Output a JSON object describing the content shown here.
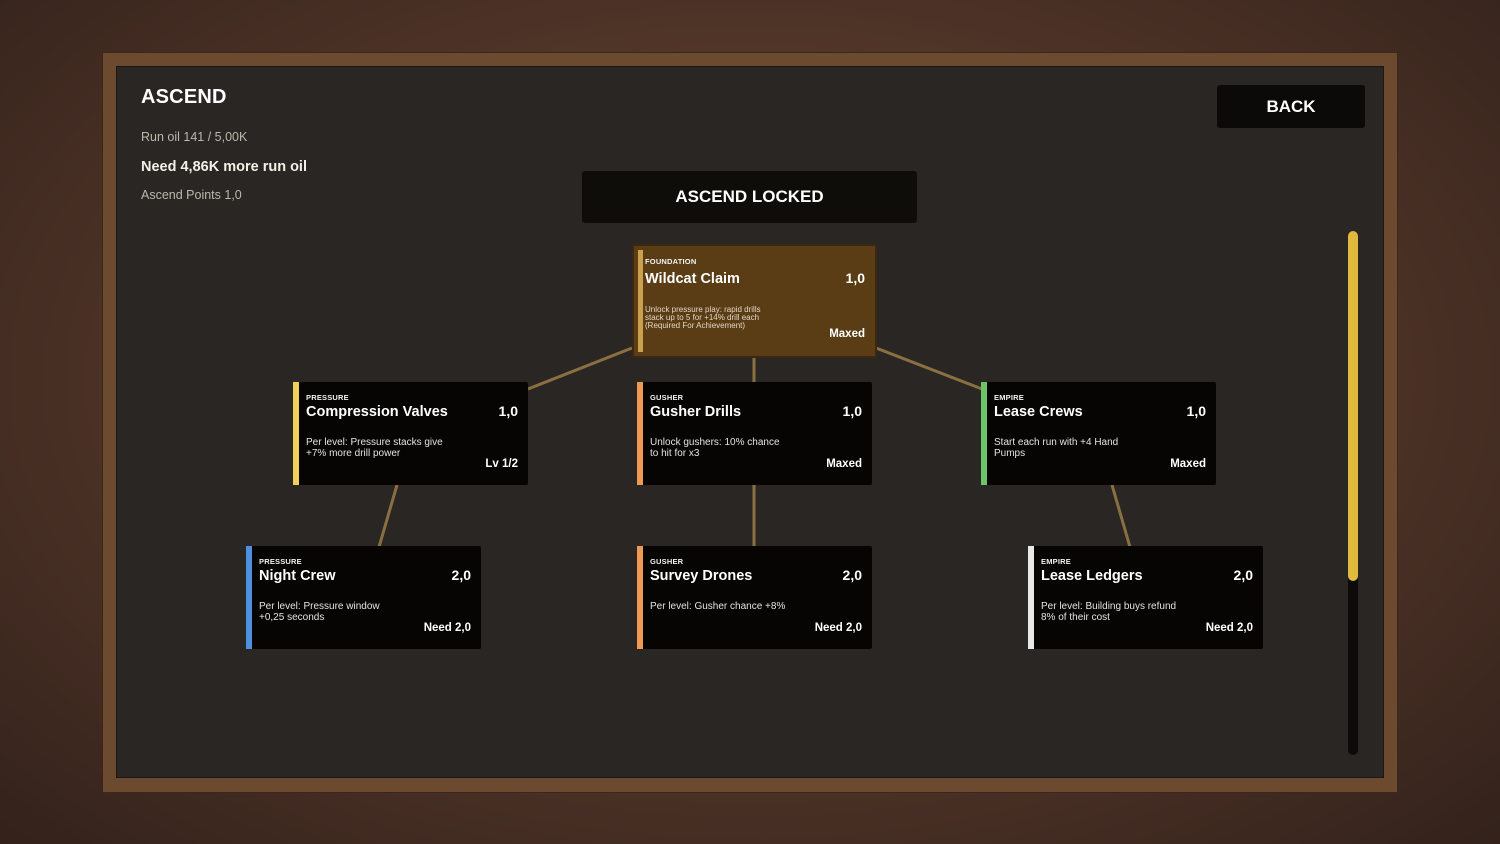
{
  "header": {
    "title": "ASCEND",
    "run_oil": "Run oil 141 / 5,00K",
    "need_oil": "Need 4,86K more run oil",
    "ascend_points": "Ascend Points 1,0",
    "back_label": "BACK",
    "ascend_button_label": "ASCEND LOCKED"
  },
  "colors": {
    "foundation": "#c9a04c",
    "pressure": "#f0cf5a",
    "gusher": "#ef9a52",
    "empire": "#6cc36a",
    "pressure_tier2": "#4f8fe0",
    "gusher_tier2": "#ef9a52",
    "empire_tier2": "#e8e8e8",
    "scrollbar": "#e2b93f"
  },
  "scroll_fraction_visible": 0.67,
  "tree": {
    "root": {
      "category": "FOUNDATION",
      "name": "Wildcat Claim",
      "cost": "1,0",
      "description": "Unlock pressure play: rapid drills stack up to 5 for +14% drill each (Required For Achievement)",
      "status": "Maxed"
    },
    "tier1": [
      {
        "category": "PRESSURE",
        "name": "Compression Valves",
        "cost": "1,0",
        "description": "Per level: Pressure stacks give +7% more drill power",
        "status": "Lv 1/2"
      },
      {
        "category": "GUSHER",
        "name": "Gusher Drills",
        "cost": "1,0",
        "description": "Unlock gushers: 10% chance to hit for x3",
        "status": "Maxed"
      },
      {
        "category": "EMPIRE",
        "name": "Lease Crews",
        "cost": "1,0",
        "description": "Start each run with +4 Hand Pumps",
        "status": "Maxed"
      }
    ],
    "tier2": [
      {
        "category": "PRESSURE",
        "name": "Night Crew",
        "cost": "2,0",
        "description": "Per level: Pressure window +0,25 seconds",
        "status": "Need 2,0"
      },
      {
        "category": "GUSHER",
        "name": "Survey Drones",
        "cost": "2,0",
        "description": "Per level: Gusher chance +8%",
        "status": "Need 2,0"
      },
      {
        "category": "EMPIRE",
        "name": "Lease Ledgers",
        "cost": "2,0",
        "description": "Per level: Building buys refund 8% of their cost",
        "status": "Need 2,0"
      }
    ]
  }
}
